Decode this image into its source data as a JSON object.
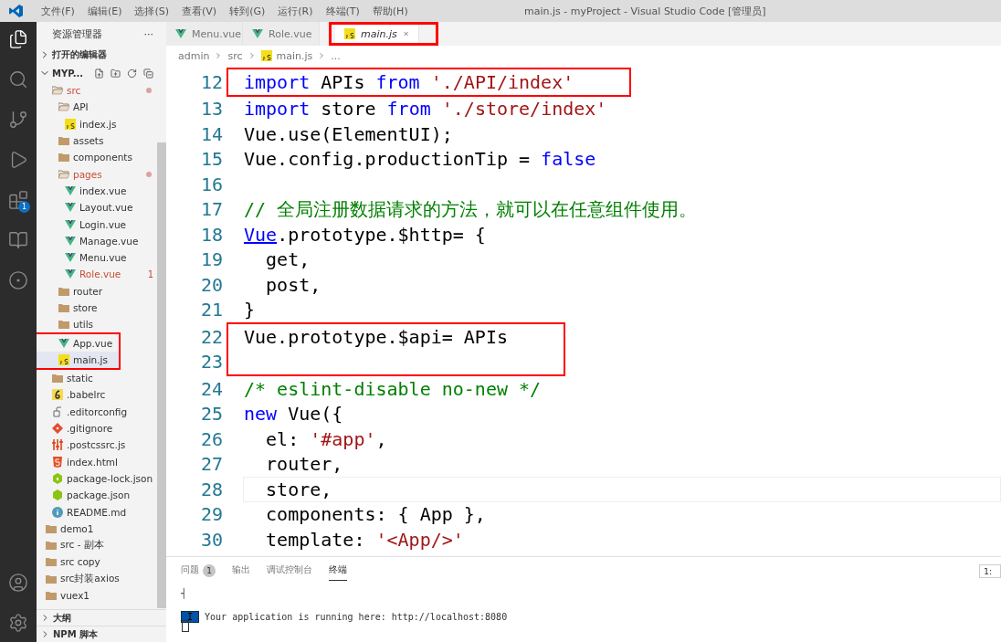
{
  "title_bar": {
    "menus": [
      "文件(F)",
      "编辑(E)",
      "选择(S)",
      "查看(V)",
      "转到(G)",
      "运行(R)",
      "终端(T)",
      "帮助(H)"
    ],
    "title": "main.js - myProject - Visual Studio Code [管理员]"
  },
  "activity_bar": {
    "items": [
      {
        "kind": "files",
        "selected": true
      },
      {
        "kind": "search",
        "selected": false
      },
      {
        "kind": "source-control",
        "selected": false
      },
      {
        "kind": "run",
        "selected": false
      },
      {
        "kind": "extensions",
        "selected": false,
        "badge": "1"
      },
      {
        "kind": "book",
        "selected": false
      },
      {
        "kind": "remote",
        "selected": false
      }
    ],
    "bottom": [
      {
        "kind": "account"
      },
      {
        "kind": "settings"
      }
    ]
  },
  "sidebar": {
    "title": "资源管理器",
    "more": "···",
    "open_editors": "打开的编辑器",
    "section": "MYP...",
    "tree": [
      {
        "children": [
          {
            "label": "src",
            "kind": "folder-open",
            "modified": true,
            "children": [
              {
                "label": "API",
                "kind": "folder-open",
                "children": [
                  {
                    "label": "index.js",
                    "kind": "js"
                  }
                ]
              },
              {
                "label": "assets",
                "kind": "folder"
              },
              {
                "label": "components",
                "kind": "folder"
              },
              {
                "label": "pages",
                "kind": "folder-open",
                "modified": true,
                "children": [
                  {
                    "label": "index.vue",
                    "kind": "vue"
                  },
                  {
                    "label": "Layout.vue",
                    "kind": "vue"
                  },
                  {
                    "label": "Login.vue",
                    "kind": "vue"
                  },
                  {
                    "label": "Manage.vue",
                    "kind": "vue"
                  },
                  {
                    "label": "Menu.vue",
                    "kind": "vue"
                  },
                  {
                    "label": "Role.vue",
                    "kind": "vue",
                    "errors": "1"
                  }
                ]
              },
              {
                "label": "router",
                "kind": "folder"
              },
              {
                "label": "store",
                "kind": "folder"
              },
              {
                "label": "utils",
                "kind": "folder"
              },
              {
                "label": "App.vue",
                "kind": "vue",
                "highlighted": true
              },
              {
                "label": "main.js",
                "kind": "js",
                "highlighted": true,
                "selected": true
              }
            ]
          },
          {
            "label": "static",
            "kind": "folder"
          },
          {
            "label": ".babelrc",
            "kind": "babel"
          },
          {
            "label": ".editorconfig",
            "kind": "editorconfig"
          },
          {
            "label": ".gitignore",
            "kind": "git"
          },
          {
            "label": ".postcssrc.js",
            "kind": "postcss"
          },
          {
            "label": "index.html",
            "kind": "html"
          },
          {
            "label": "package-lock.json",
            "kind": "npm-lock"
          },
          {
            "label": "package.json",
            "kind": "npm"
          },
          {
            "label": "README.md",
            "kind": "info"
          }
        ]
      },
      {
        "label": "demo1",
        "kind": "folder"
      },
      {
        "label": "src - 副本",
        "kind": "folder"
      },
      {
        "label": "src copy",
        "kind": "folder"
      },
      {
        "label": "src封装axios",
        "kind": "folder"
      },
      {
        "label": "vuex1",
        "kind": "folder"
      }
    ],
    "bottom_sections": [
      "大纲",
      "NPM 脚本"
    ]
  },
  "tabs": [
    {
      "label": "Menu.vue",
      "kind": "vue",
      "selected": false,
      "highlighted": false
    },
    {
      "label": "Role.vue",
      "kind": "vue",
      "selected": false,
      "highlighted": false
    },
    {
      "label": "main.js",
      "kind": "js",
      "selected": true,
      "highlighted": true
    }
  ],
  "breadcrumb": [
    "admin",
    "src",
    "main.js",
    "..."
  ],
  "code": [
    {
      "number": "12",
      "highlighted": true,
      "tokens": [
        {
          "kind": "keyword",
          "text": "import"
        },
        {
          "kind": "plain",
          "text": " APIs "
        },
        {
          "kind": "keyword",
          "text": "from"
        },
        {
          "kind": "string",
          "text": " './API/index'"
        }
      ]
    },
    {
      "number": "13",
      "tokens": [
        {
          "kind": "keyword",
          "text": "import"
        },
        {
          "kind": "plain",
          "text": " store "
        },
        {
          "kind": "keyword",
          "text": "from"
        },
        {
          "kind": "string",
          "text": " './store/index'"
        }
      ]
    },
    {
      "number": "14",
      "tokens": [
        {
          "kind": "plain",
          "text": "Vue.use(ElementUI);"
        }
      ]
    },
    {
      "number": "15",
      "tokens": [
        {
          "kind": "plain",
          "text": "Vue.config.productionTip = "
        },
        {
          "kind": "keyword",
          "text": "false"
        }
      ]
    },
    {
      "number": "16"
    },
    {
      "number": "17",
      "tokens": [
        {
          "kind": "comment",
          "text": "// 全局注册数据请求的方法，就可以在任意组件使用。"
        }
      ]
    },
    {
      "number": "18",
      "tokens": [
        {
          "kind": "link",
          "text": "Vue"
        },
        {
          "kind": "plain",
          "text": ".prototype.$http= {"
        }
      ]
    },
    {
      "number": "19",
      "tokens": [
        {
          "kind": "plain",
          "text": "  get,"
        }
      ]
    },
    {
      "number": "20",
      "tokens": [
        {
          "kind": "plain",
          "text": "  post,"
        }
      ]
    },
    {
      "number": "21",
      "tokens": [
        {
          "kind": "plain",
          "text": "}"
        }
      ]
    },
    {
      "number": "22",
      "highlighted": true,
      "tokens": [
        {
          "kind": "plain",
          "text": "Vue.prototype.$api= APIs"
        }
      ]
    },
    {
      "number": "23",
      "highlighted": true
    },
    {
      "number": "24",
      "tokens": [
        {
          "kind": "comment",
          "text": "/* eslint-disable no-new */"
        }
      ]
    },
    {
      "number": "25",
      "tokens": [
        {
          "kind": "keyword",
          "text": "new"
        },
        {
          "kind": "plain",
          "text": " Vue({"
        }
      ]
    },
    {
      "number": "26",
      "tokens": [
        {
          "kind": "plain",
          "text": "  el: "
        },
        {
          "kind": "string",
          "text": "'#app'"
        },
        {
          "kind": "plain",
          "text": ","
        }
      ]
    },
    {
      "number": "27",
      "tokens": [
        {
          "kind": "plain",
          "text": "  router,"
        }
      ]
    },
    {
      "number": "28",
      "current": true,
      "tokens": [
        {
          "kind": "plain",
          "text": "  store,"
        }
      ]
    },
    {
      "number": "29",
      "tokens": [
        {
          "kind": "plain",
          "text": "  components: { App },"
        }
      ]
    },
    {
      "number": "30",
      "tokens": [
        {
          "kind": "plain",
          "text": "  template: "
        },
        {
          "kind": "string",
          "text": "'<App/>'"
        }
      ]
    }
  ],
  "panel": {
    "tabs": [
      {
        "label": "问题",
        "badge": "1",
        "selected": false
      },
      {
        "label": "输出",
        "selected": false
      },
      {
        "label": "调试控制台",
        "selected": false
      },
      {
        "label": "终端",
        "selected": true
      }
    ],
    "terminal_selector": "1:",
    "terminal": {
      "prompt_mark": "┤",
      "tag": "I",
      "message": "Your application is running here: http://localhost:8080"
    }
  }
}
